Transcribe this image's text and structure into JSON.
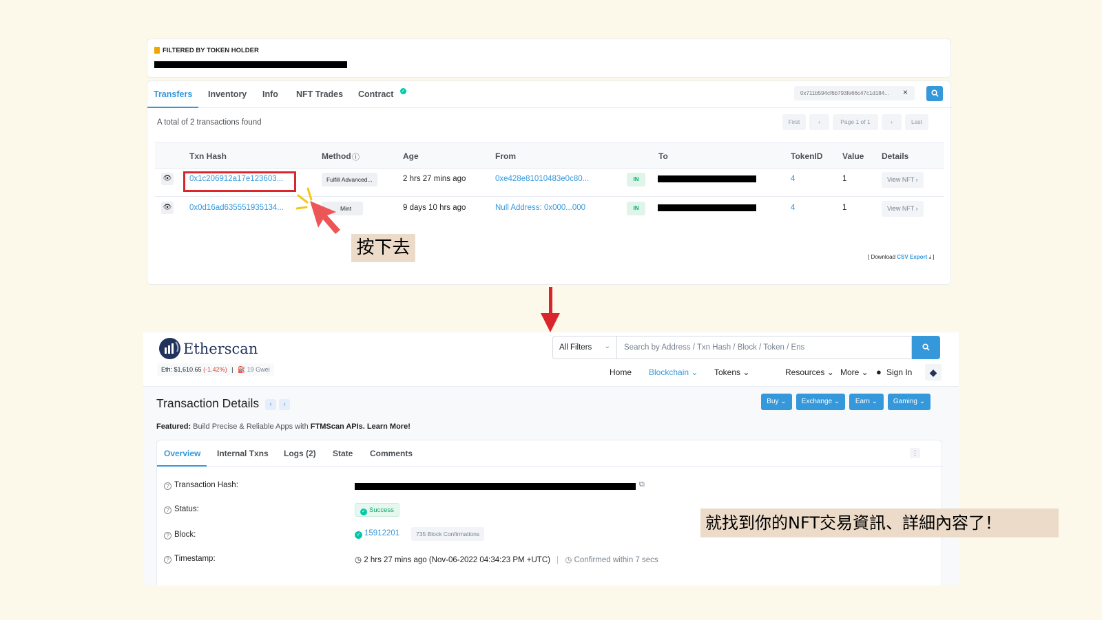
{
  "top": {
    "holder_title": "FILTERED BY TOKEN HOLDER",
    "tabs": [
      "Transfers",
      "Inventory",
      "Info",
      "NFT Trades",
      "Contract"
    ],
    "filter_address": "0x711b594cf6b793fe66c47c1d184...",
    "filter_clear": "×",
    "total_text": "A total of 2 transactions found",
    "pagination": {
      "first": "First",
      "prev": "‹",
      "page": "Page 1 of 1",
      "next": "›",
      "last": "Last"
    },
    "columns": [
      "Txn Hash",
      "Method",
      "Age",
      "From",
      "To",
      "TokenID",
      "Value",
      "Details"
    ],
    "method_info_icon": "ⓘ",
    "rows": [
      {
        "hash": "0x1c206912a17e123603...",
        "method": "Fulfill Advanced...",
        "age": "2 hrs 27 mins ago",
        "from": "0xe428e81010483e0c80...",
        "direction": "IN",
        "token_id": "4",
        "value": "1",
        "details": "View NFT ›"
      },
      {
        "hash": "0x0d16ad635551935134...",
        "method": "Mint",
        "age": "9 days 10 hrs ago",
        "from": "Null Address: 0x000...000",
        "direction": "IN",
        "token_id": "4",
        "value": "1",
        "details": "View NFT ›"
      }
    ],
    "csv": {
      "prefix": "[ Download ",
      "link": "CSV Export",
      "suffix": " ⤓ ]"
    },
    "press_label": "按下去"
  },
  "etherscan": {
    "brand": "Etherscan",
    "price": {
      "eth": "Eth: $1,610.65",
      "change": "(-1.42%)",
      "sep": "|",
      "gas": "⛽ 19 Gwei"
    },
    "filter_select": "All Filters",
    "search_placeholder": "Search by Address / Txn Hash / Block / Token / Ens",
    "nav": [
      "Home",
      "Blockchain ⌄",
      "Tokens ⌄",
      "Resources ⌄",
      "More ⌄",
      "Sign In"
    ],
    "page_title": "Transaction Details",
    "buttons": [
      "Buy ⌄",
      "Exchange ⌄",
      "Earn ⌄",
      "Gaming ⌄"
    ],
    "featured": {
      "label": "Featured:",
      "text": " Build Precise & Reliable Apps with ",
      "brand": "FTMScan APIs.",
      "link": " Learn More!"
    },
    "tabs": [
      "Overview",
      "Internal Txns",
      "Logs (2)",
      "State",
      "Comments"
    ],
    "details": {
      "hash_label": "Transaction Hash:",
      "status_label": "Status:",
      "status_value": "Success",
      "block_label": "Block:",
      "block_value": "15912201",
      "block_confirmations": "735 Block Confirmations",
      "timestamp_label": "Timestamp:",
      "timestamp_value": "2 hrs 27 mins ago (Nov-06-2022 04:34:23 PM +UTC)",
      "timestamp_sep": "|",
      "confirmed": "Confirmed within 7 secs"
    },
    "found_label": "就找到你的NFT交易資訊、詳細內容了！"
  }
}
